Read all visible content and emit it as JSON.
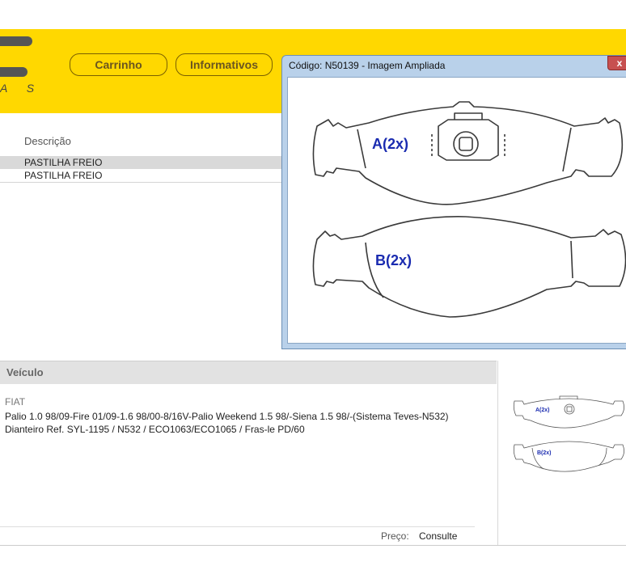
{
  "header": {
    "logo_text": "A S",
    "nav": [
      {
        "label": "Carrinho"
      },
      {
        "label": "Informativos"
      }
    ]
  },
  "products": {
    "column_header": "Descrição",
    "rows": [
      {
        "description": "PASTILHA FREIO"
      },
      {
        "description": "PASTILHA FREIO"
      }
    ]
  },
  "vehicle": {
    "header": "Veículo",
    "brand": "FIAT",
    "description_line1": "Palio 1.0 98/09-Fire 01/09-1.6 98/00-8/16V-Palio Weekend 1.5 98/-Siena 1.5 98/-(Sistema Teves-N532)",
    "description_line2": "Dianteiro Ref. SYL-1195 / N532 / ECO1063/ECO1065 / Fras-le PD/60",
    "price_label": "Preço:",
    "price_value": "Consulte"
  },
  "popup": {
    "title": "Código: N50139 - Imagem Ampliada",
    "close_glyph": "x",
    "label_a": "A(2x)",
    "label_b": "B(2x)"
  },
  "colors": {
    "header_bg": "#ffd800",
    "selected_row": "#d9d9d9",
    "label_blue": "#1a2bb0"
  }
}
